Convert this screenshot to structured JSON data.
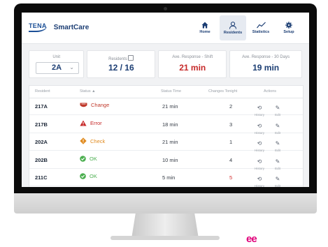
{
  "app": {
    "brand": "TENA",
    "name": "SmartCare"
  },
  "nav": [
    {
      "label": "Home",
      "icon": "home-icon"
    },
    {
      "label": "Residents",
      "icon": "person-icon",
      "active": true
    },
    {
      "label": "Statistics",
      "icon": "chart-icon"
    },
    {
      "label": "Setup",
      "icon": "gear-icon"
    }
  ],
  "stats": {
    "unit_label": "Unit",
    "unit_value": "2A",
    "residents_label": "Residents",
    "residents_value": "12 / 16",
    "shift_label": "Ave. Response - Shift",
    "shift_value": "21 min",
    "days_label": "Ave. Response - 30 Days",
    "days_value": "19 min"
  },
  "table": {
    "headers": {
      "resident": "Resident",
      "status": "Status ▲",
      "time": "Status Time",
      "changes": "Changes Tonight",
      "actions": "Actions"
    },
    "action_labels": {
      "history": "History",
      "edit": "Edit"
    },
    "rows": [
      {
        "resident": "217A",
        "status": "Change",
        "status_type": "change",
        "color": "#c0392b",
        "time": "21 min",
        "changes": "2",
        "changes_color": "#333a44"
      },
      {
        "resident": "217B",
        "status": "Error",
        "status_type": "error",
        "color": "#c62828",
        "time": "18 min",
        "changes": "3",
        "changes_color": "#333a44"
      },
      {
        "resident": "202A",
        "status": "Check",
        "status_type": "check",
        "color": "#e08a1e",
        "time": "21 min",
        "changes": "1",
        "changes_color": "#333a44"
      },
      {
        "resident": "202B",
        "status": "OK",
        "status_type": "ok",
        "color": "#4caf50",
        "time": "10 min",
        "changes": "4",
        "changes_color": "#333a44"
      },
      {
        "resident": "211C",
        "status": "OK",
        "status_type": "ok",
        "color": "#4caf50",
        "time": "5 min",
        "changes": "5",
        "changes_color": "#d32f2f"
      }
    ]
  },
  "vendor_logo": "ee"
}
